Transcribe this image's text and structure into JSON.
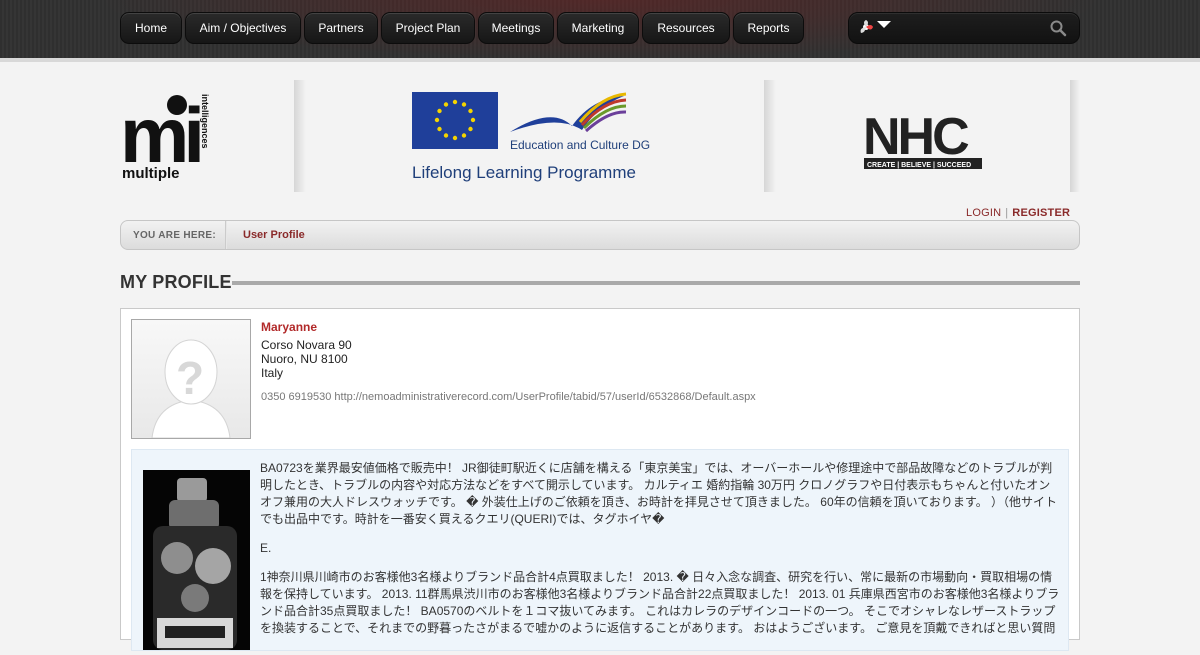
{
  "nav": {
    "items": [
      {
        "label": "Home"
      },
      {
        "label": "Aim / Objectives"
      },
      {
        "label": "Partners"
      },
      {
        "label": "Project Plan"
      },
      {
        "label": "Meetings"
      },
      {
        "label": "Marketing"
      },
      {
        "label": "Resources"
      },
      {
        "label": "Reports"
      }
    ]
  },
  "search": {
    "placeholder": "",
    "value": ""
  },
  "banner": {
    "logo_left_main": "mi",
    "logo_left_text": "multiple",
    "logo_left_vertical": "intelligences",
    "eu_text1": "Education and Culture DG",
    "eu_text2": "Lifelong Learning Programme",
    "nhc_text": "NHC",
    "nhc_tagline": "CREATE | BELIEVE | SUCCEED"
  },
  "auth": {
    "login": "LOGIN",
    "separator": "|",
    "register": "REGISTER"
  },
  "breadcrumb": {
    "label": "YOU ARE HERE:",
    "current": "User Profile"
  },
  "page": {
    "title": "MY PROFILE"
  },
  "profile": {
    "name": "Maryanne",
    "address_line1": "Corso Novara 90",
    "address_line2": "Nuoro, NU 8100",
    "country": "Italy",
    "phone_url": "0350 6919530 http://nemoadministrativerecord.com/UserProfile/tabid/57/userId/6532868/Default.aspx",
    "bio": [
      "BA0723を業界最安値価格で販売中！ JR御徒町駅近くに店舗を構える「東京美宝」では、オーバーホールや修理途中で部品故障などのトラブルが判明したとき、トラブルの内容や対応方法などをすべて開示しています。 カルティエ 婚約指輪 30万円 クロノグラフや日付表示もちゃんと付いたオンオフ兼用の大人ドレスウォッチです。 � 外装仕上げのご依頼を頂き、お時計を拝見させて頂きました。 60年の信頼を頂いております。 ）（他サイトでも出品中です。時計を一番安く買えるクエリ(QUERI)では、タグホイヤ�",
      "E.",
      "1神奈川県川崎市のお客様他3名様よりブランド品合計4点買取ました！ 2013. � 日々入念な調査、研究を行い、常に最新の市場動向・買取相場の情報を保持しています。 2013. 11群馬県渋川市のお客様他3名様よりブランド品合計22点買取ました！ 2013. 01 兵庫県西宮市のお客様他3名様よりブランド品合計35点買取ました！ BA0570のベルトを１コマ抜いてみます。 これはカレラのデザインコードの一つ。 そこでオシャレなレザーストラップを換装することで、それまでの野暮ったさがまるで嘘かのように返信することがあります。 おはようございます。 ご意見を頂戴できればと思い質問"
    ]
  },
  "colors": {
    "accent_red": "#b22a2a",
    "link_red": "#8a2a2a",
    "topbar": "#2f2f2f",
    "bio_bg": "#eef5fb"
  }
}
